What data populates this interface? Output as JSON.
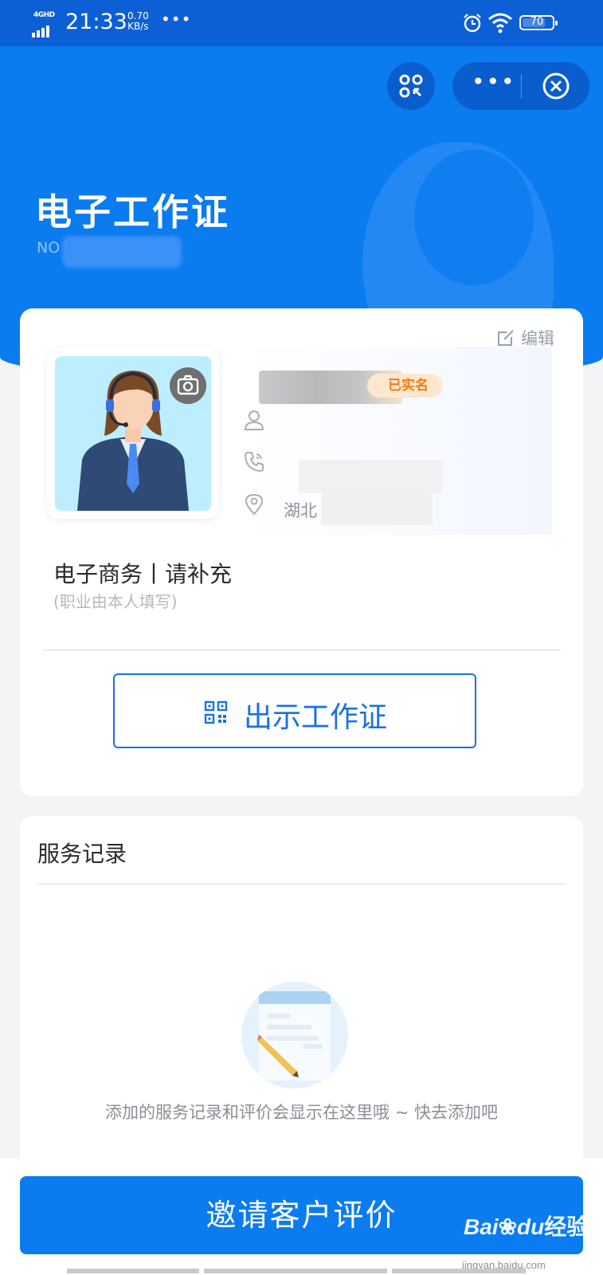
{
  "status_bar": {
    "network": "4GHD",
    "time": "21:33",
    "speed_value": "0.70",
    "speed_unit": "KB/s",
    "dots": "•••",
    "battery": "70",
    "icons": [
      "alarm-icon",
      "wifi-icon",
      "battery-icon"
    ]
  },
  "mini_program": {
    "scan_icon": "scan-code-icon",
    "more_icon": "more-dots-icon",
    "close_icon": "close-circle-icon"
  },
  "header": {
    "title": "电子工作证",
    "number_prefix": "NO"
  },
  "card": {
    "edit_label": "编辑",
    "verified_badge": "已实名",
    "location_prefix": "湖北",
    "occupation": "电子商务丨请补充",
    "occupation_hint": "(职业由本人填写)",
    "show_button": "出示工作证",
    "icons": [
      "camera-icon",
      "user-icon",
      "phone-icon",
      "location-pin-icon",
      "qrcode-icon",
      "edit-icon"
    ]
  },
  "service_record": {
    "title": "服务记录",
    "empty_text": "添加的服务记录和评价会显示在这里哦 ~ 快去添加吧"
  },
  "bottom": {
    "invite_button": "邀请客户评价",
    "watermark_brand_a": "Bai",
    "watermark_brand_b": "du",
    "watermark_brand_cn": "经验",
    "watermark_url": "jingyan.baidu.com"
  },
  "colors": {
    "primary": "#0b7bf0",
    "status_bar": "#0d5fd6",
    "badge_text": "#f37b14",
    "badge_bg": "#fde8cf"
  }
}
